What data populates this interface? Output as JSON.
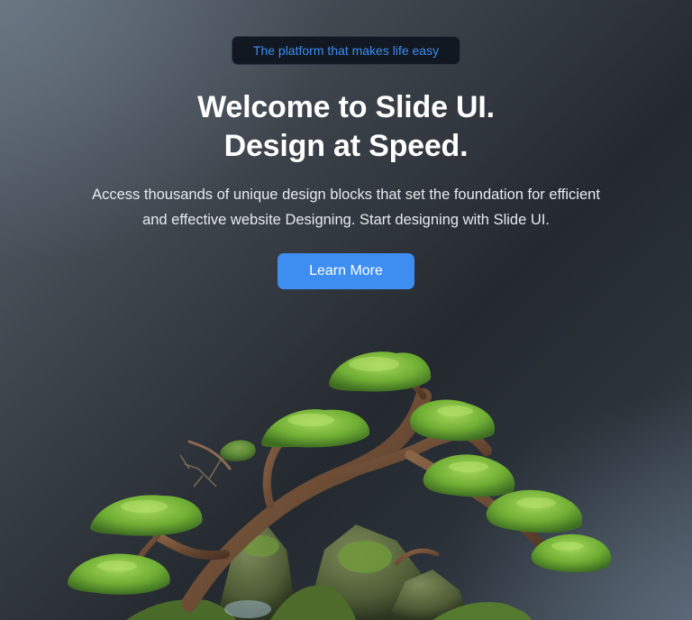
{
  "badge": {
    "label": "The platform that makes life easy"
  },
  "hero": {
    "title_line1": "Welcome to Slide UI.",
    "title_line2": "Design at Speed.",
    "description_line1": "Access thousands of unique design blocks that set the foundation for efficient",
    "description_line2": "and effective website Designing. Start designing with Slide UI.",
    "cta_label": "Learn More"
  },
  "illustration": {
    "icon": "bonsai-tree-image"
  },
  "colors": {
    "accent": "#3d8ef0",
    "badge_text": "#3b8df0",
    "badge_bg": "#121821",
    "foliage": "#7cb83a",
    "trunk": "#6b4a33",
    "moss_rock": "#5a6e3a"
  }
}
